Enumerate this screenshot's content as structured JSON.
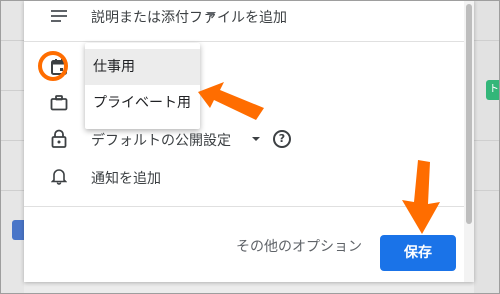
{
  "dialog": {
    "description_label": "説明または添付ファイルを追加",
    "visibility_label": "デフォルトの公開設定",
    "help_label": "?",
    "notification_label": "通知を追加",
    "more_options_label": "その他のオプション",
    "save_label": "保存"
  },
  "calendar_menu": {
    "items": [
      {
        "label": "仕事用",
        "selected": true
      },
      {
        "label": "プライベート用",
        "selected": false
      }
    ]
  },
  "background": {
    "right_chip_label": "ト"
  },
  "colors": {
    "accent": "#1a73e8",
    "annotation": "#ff6d00"
  },
  "icons": [
    "description-icon",
    "calendar-icon",
    "briefcase-icon",
    "lock-icon",
    "bell-icon",
    "help-icon",
    "dropdown-caret-icon"
  ]
}
